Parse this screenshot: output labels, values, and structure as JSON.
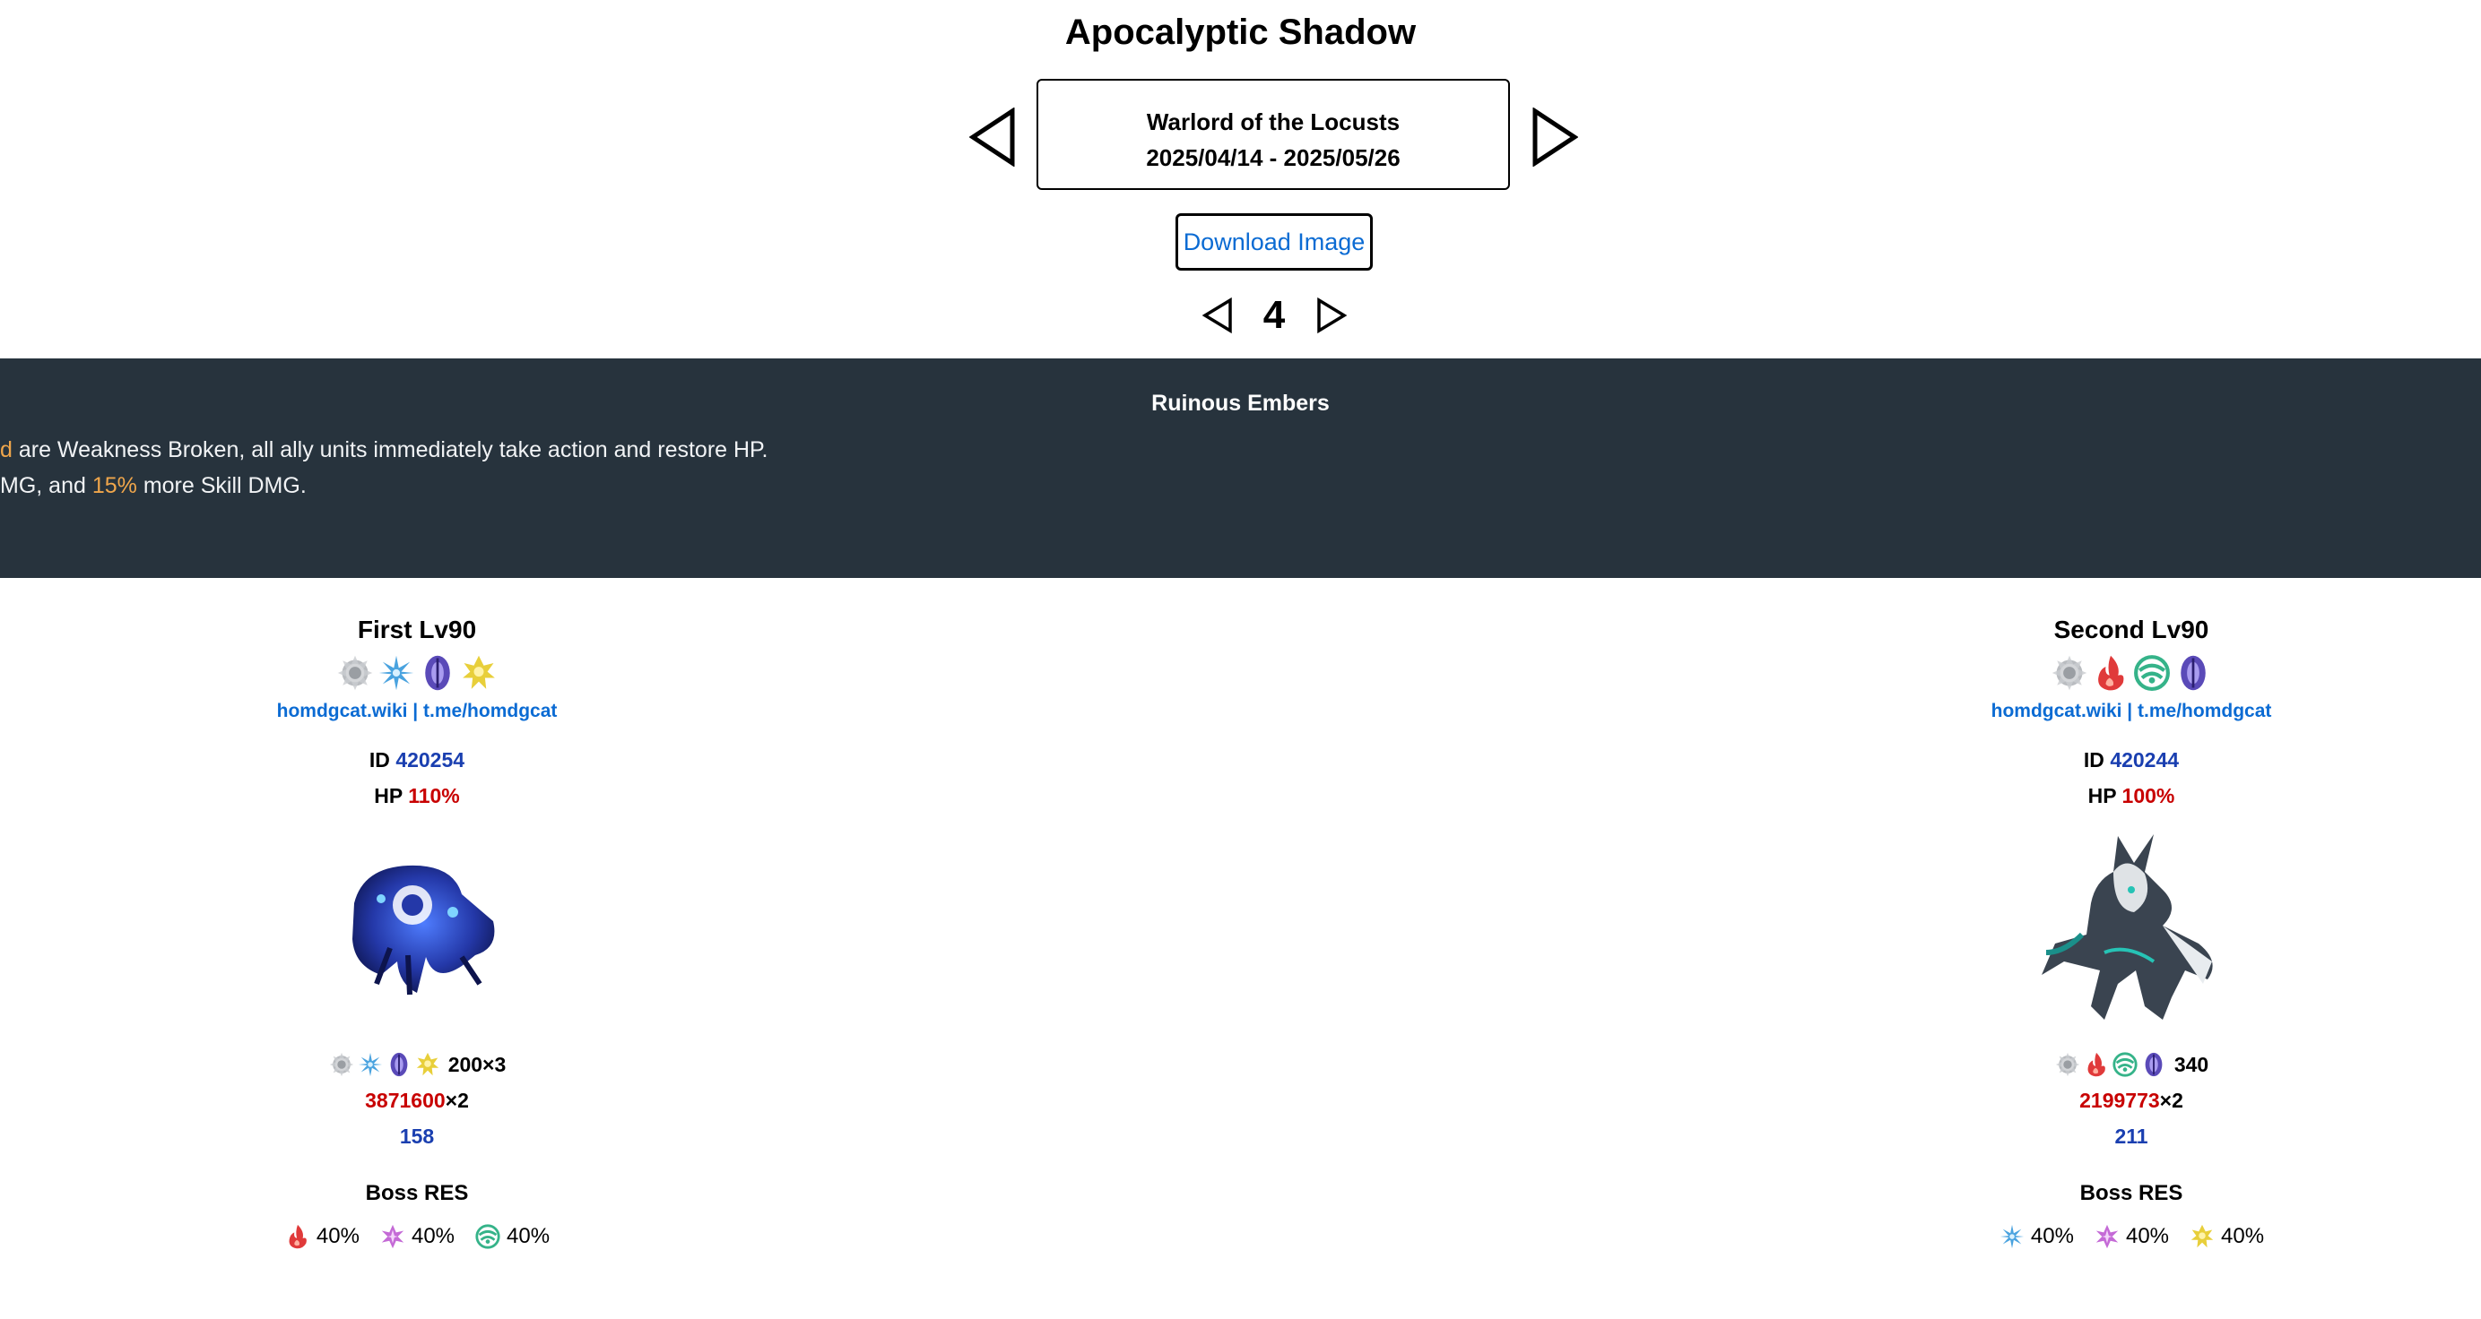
{
  "title": "Apocalyptic Shadow",
  "boss_selector": {
    "name": "Warlord of the Locusts",
    "dates": "2025/04/14 - 2025/05/26",
    "prev_icon": "triangle-left-icon",
    "next_icon": "triangle-right-icon"
  },
  "download_label": "Download Image",
  "stage_number": "4",
  "buff": {
    "title": "Ruinous Embers",
    "line1_highlight": "d",
    "line1_text": " are Weakness Broken, all ally units immediately take action and restore HP.",
    "line2_prefix": "MG, and ",
    "line2_highlight": "15%",
    "line2_suffix": " more Skill DMG."
  },
  "enemies": [
    {
      "header": "First Lv90",
      "weaknesses": [
        "physical-icon",
        "ice-icon",
        "quantum-icon",
        "imaginary-icon"
      ],
      "credit": "homdgcat.wiki | t.me/homdgcat",
      "id_label": "ID",
      "id_value": "420254",
      "hp_label": "HP",
      "hp_value": "110%",
      "portrait": "blue-armored-beast-icon",
      "toughness_text": "200×3",
      "hp_number": "3871600",
      "hp_multiplier": "×2",
      "speed": "158",
      "res_header": "Boss RES",
      "res": [
        {
          "element": "fire-icon",
          "value": "40%"
        },
        {
          "element": "lightning-icon",
          "value": "40%"
        },
        {
          "element": "wind-icon",
          "value": "40%"
        }
      ]
    },
    {
      "header": "Second Lv90",
      "weaknesses": [
        "physical-icon",
        "fire-icon",
        "wind-icon",
        "quantum-icon"
      ],
      "credit": "homdgcat.wiki | t.me/homdgcat",
      "id_label": "ID",
      "id_value": "420244",
      "hp_label": "HP",
      "hp_value": "100%",
      "portrait": "warlord-wolf-warrior-icon",
      "toughness_text": "340",
      "hp_number": "2199773",
      "hp_multiplier": "×2",
      "speed": "211",
      "res_header": "Boss RES",
      "res": [
        {
          "element": "ice-icon",
          "value": "40%"
        },
        {
          "element": "lightning-icon",
          "value": "40%"
        },
        {
          "element": "imaginary-icon",
          "value": "40%"
        }
      ]
    }
  ],
  "colors": {
    "banner": "#27333d",
    "highlight": "#f0a64b",
    "link": "#0b6bd3",
    "id_blue": "#1a3fb0",
    "hp_red": "#c80000"
  }
}
